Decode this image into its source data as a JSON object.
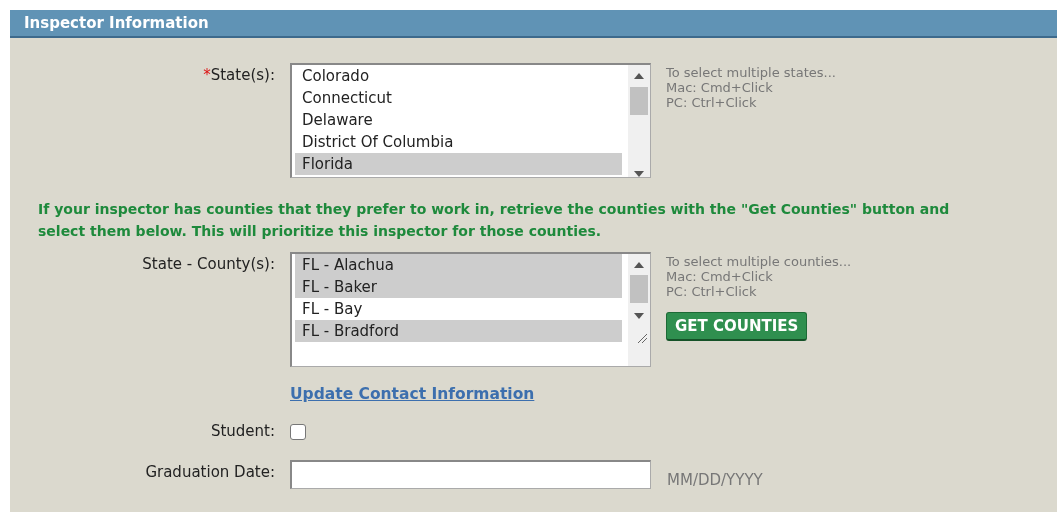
{
  "section": {
    "title": "Inspector Information"
  },
  "states": {
    "label": "State(s):",
    "required_mark": "*",
    "options": [
      {
        "label": "Colorado",
        "selected": false
      },
      {
        "label": "Connecticut",
        "selected": false
      },
      {
        "label": "Delaware",
        "selected": false
      },
      {
        "label": "District Of Columbia",
        "selected": false
      },
      {
        "label": "Florida",
        "selected": true
      }
    ],
    "hint": [
      "To select multiple states...",
      "Mac: Cmd+Click",
      "PC: Ctrl+Click"
    ]
  },
  "notice": "If your inspector has counties that they prefer to work in, retrieve the counties with the \"Get Counties\" button and select them below. This will prioritize this inspector for those counties.",
  "counties": {
    "label": "State - County(s):",
    "options": [
      {
        "label": "FL - Alachua",
        "selected": true
      },
      {
        "label": "FL - Baker",
        "selected": true
      },
      {
        "label": "FL - Bay",
        "selected": false
      },
      {
        "label": "FL - Bradford",
        "selected": true
      }
    ],
    "hint": [
      "To select multiple counties...",
      "Mac: Cmd+Click",
      "PC: Ctrl+Click"
    ],
    "button": "GET COUNTIES"
  },
  "link": "Update Contact Information",
  "student": {
    "label": "Student:",
    "checked": false
  },
  "graduation_date": {
    "label": "Graduation Date:",
    "format_hint": "MM/DD/YYYY"
  }
}
